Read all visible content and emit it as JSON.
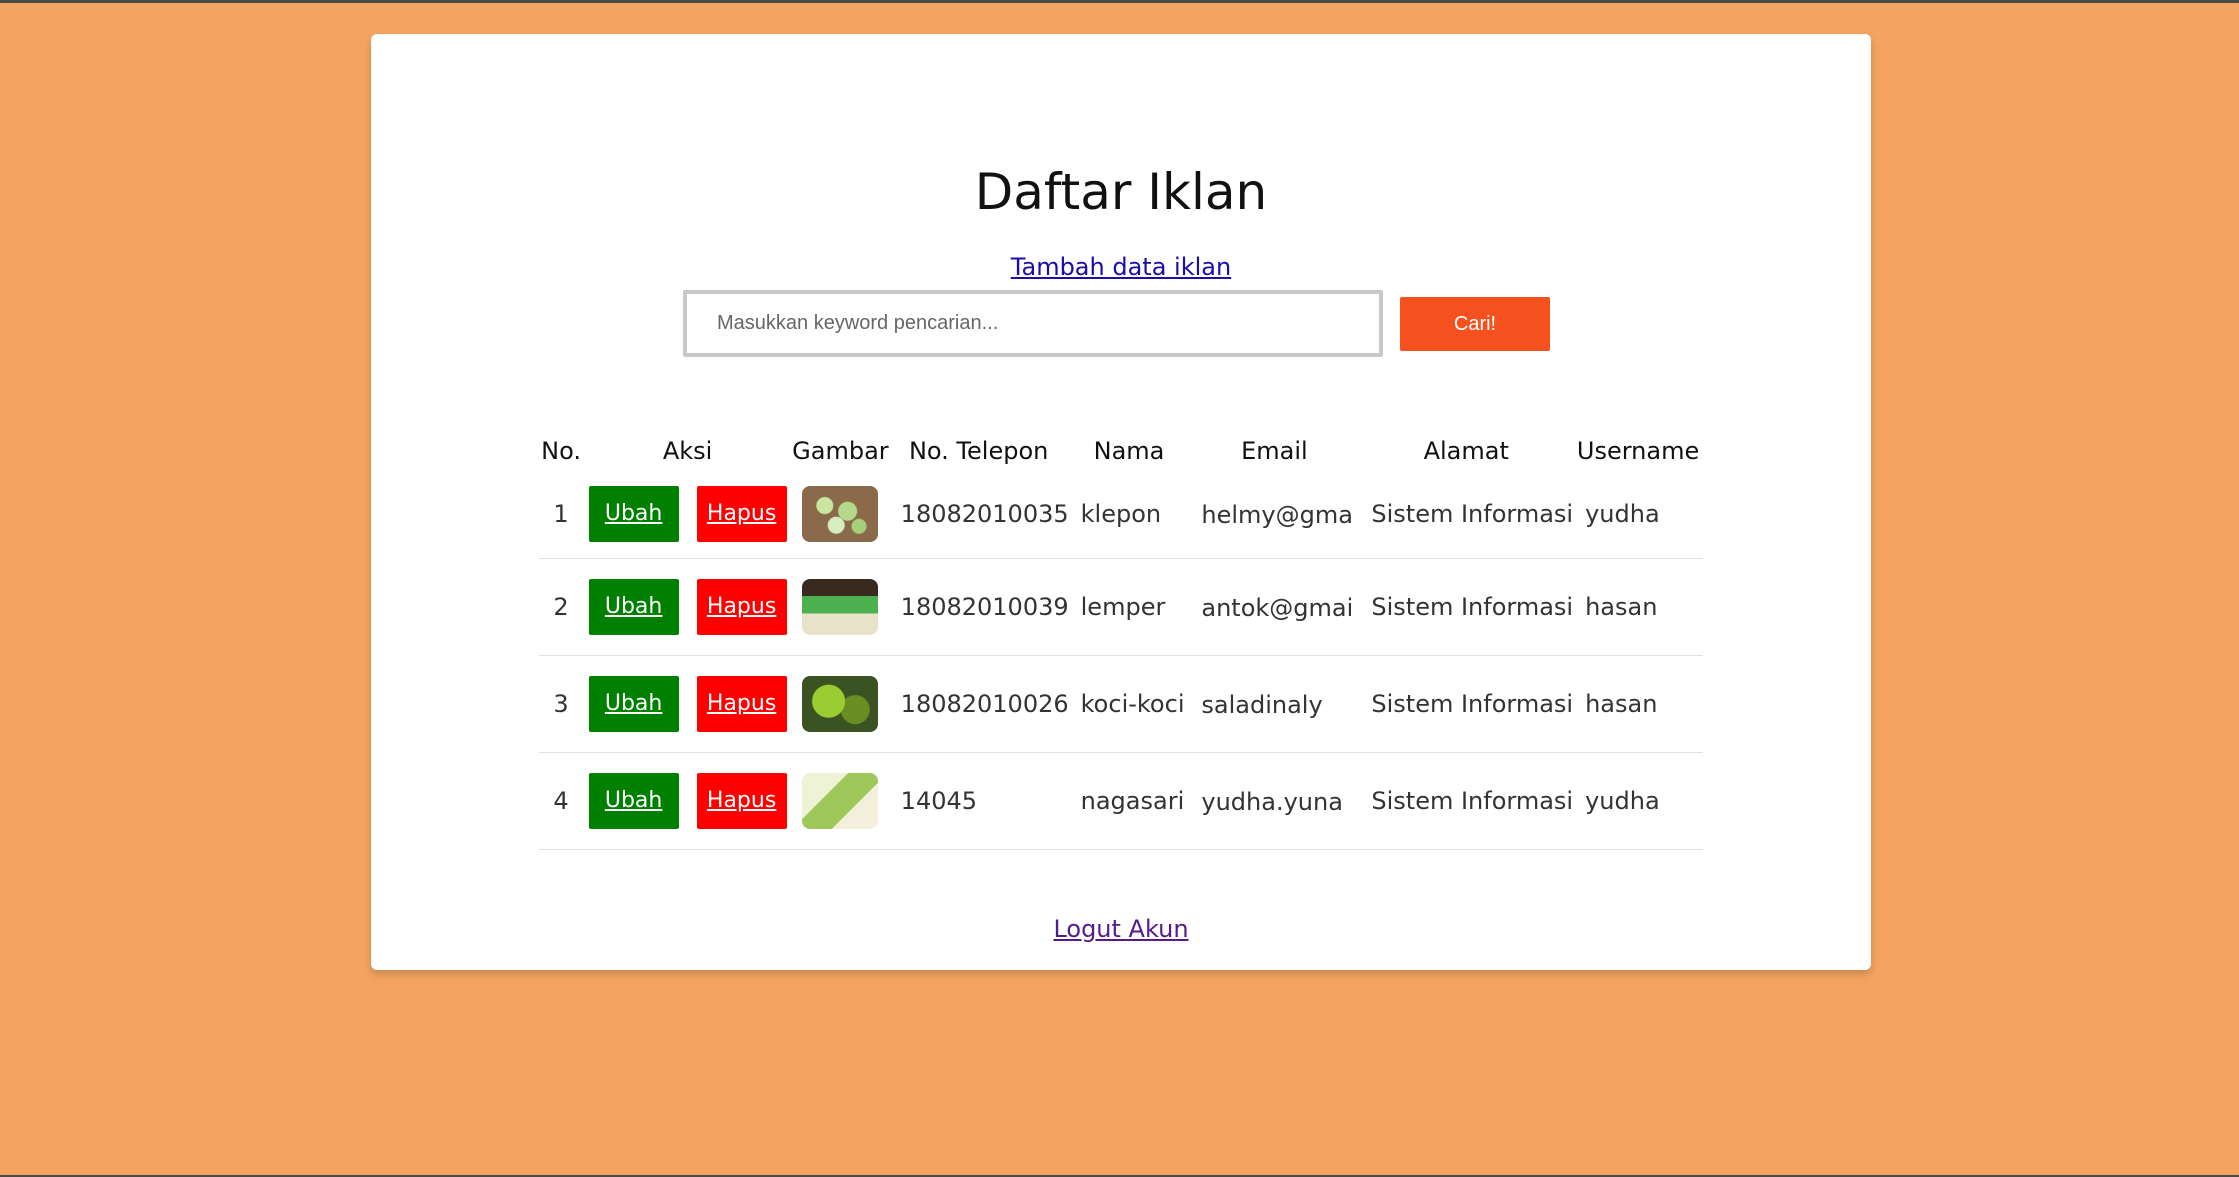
{
  "page": {
    "title": "Daftar Iklan",
    "add_link_label": "Tambah data iklan",
    "logout_label": "Logut Akun"
  },
  "search": {
    "placeholder": "Masukkan keyword pencarian...",
    "value": "",
    "button_label": "Cari!"
  },
  "table": {
    "headers": [
      "No.",
      "Aksi",
      "Gambar",
      "No. Telepon",
      "Nama",
      "Email",
      "Alamat",
      "Username"
    ],
    "action_labels": {
      "edit": "Ubah",
      "delete": "Hapus"
    },
    "rows": [
      {
        "no": "1",
        "image": "klepon-photo",
        "phone": "18082010035",
        "name": "klepon",
        "email": "helmy@gmai",
        "address": "Sistem Informasi",
        "username": "yudha"
      },
      {
        "no": "2",
        "image": "lemper-photo",
        "phone": "18082010039",
        "name": "lemper",
        "email": "antok@gmai",
        "address": "Sistem Informasi",
        "username": "hasan"
      },
      {
        "no": "3",
        "image": "koci-koci-photo",
        "phone": "18082010026",
        "name": "koci-koci",
        "email": "saladinaly",
        "address": "Sistem Informasi",
        "username": "hasan"
      },
      {
        "no": "4",
        "image": "nagasari-photo",
        "phone": "14045",
        "name": "nagasari",
        "email": "yudha.yuna",
        "address": "Sistem Informasi",
        "username": "yudha"
      }
    ]
  },
  "colors": {
    "background": "#f4a460",
    "card": "#ffffff",
    "search_button": "#f4511e",
    "edit_button": "#008000",
    "delete_button": "#ff0000",
    "link": "#1a0dab",
    "visited_link": "#551a8b"
  }
}
